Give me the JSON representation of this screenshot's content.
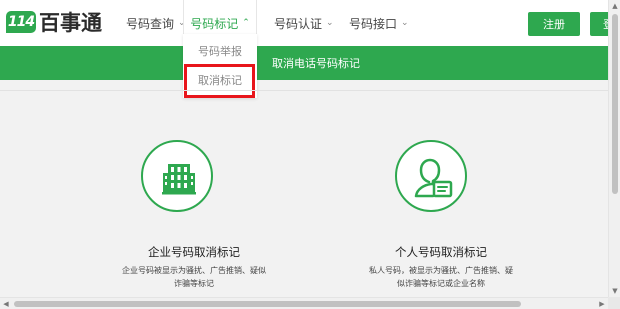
{
  "logo": {
    "badge": "114",
    "name": "百事通"
  },
  "nav": {
    "items": [
      {
        "label": "号码查询",
        "chevron": "⌄"
      },
      {
        "label": "号码标记",
        "chevron": "⌃"
      },
      {
        "label": "号码认证",
        "chevron": "⌄"
      },
      {
        "label": "号码接口",
        "chevron": "⌄"
      }
    ],
    "register_label": "注册",
    "login_label": "登"
  },
  "dropdown": {
    "items": [
      {
        "label": "号码举报"
      },
      {
        "label": "取消标记"
      }
    ],
    "highlight_color": "#e8151b"
  },
  "banner": {
    "title": "取消电话号码标记"
  },
  "cards": [
    {
      "title": "企业号码取消标记",
      "desc_line1": "企业号码被显示为骚扰、广告推销、疑似",
      "desc_line2": "诈骗等标记",
      "icon": "building-icon"
    },
    {
      "title": "个人号码取消标记",
      "desc_line1": "私人号码，被显示为骚扰、广告推销、疑",
      "desc_line2": "似诈骗等标记或企业名称",
      "icon": "person-id-icon"
    }
  ],
  "colors": {
    "brand_green": "#2ea84f",
    "highlight_red": "#e8151b"
  }
}
